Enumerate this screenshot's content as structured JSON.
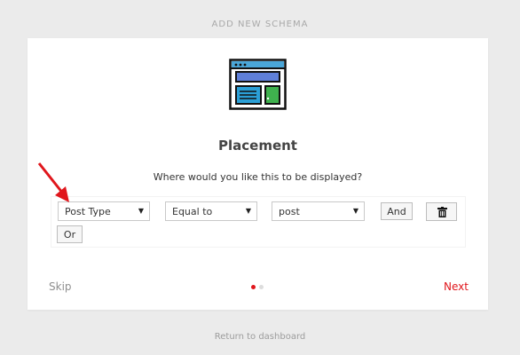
{
  "header": {
    "title": "ADD NEW SCHEMA"
  },
  "wizard": {
    "icon": "placement-layout-icon",
    "heading": "Placement",
    "question": "Where would you like this to be displayed?",
    "rule": {
      "field": {
        "value": "Post Type",
        "icon": "caret-down-icon"
      },
      "operator": {
        "value": "Equal to",
        "icon": "caret-down-icon"
      },
      "target": {
        "value": "post",
        "icon": "caret-down-icon"
      },
      "and_label": "And",
      "or_label": "Or",
      "delete_icon": "trash-icon"
    },
    "skip_label": "Skip",
    "next_label": "Next",
    "steps": {
      "current": 1,
      "total": 2
    }
  },
  "footer": {
    "return_label": "Return to dashboard"
  },
  "annotation": {
    "arrow_color": "#e0161c",
    "arrow_icon": "red-arrow-icon"
  },
  "colors": {
    "accent": "#e0161c",
    "background": "#ebebeb",
    "card": "#ffffff"
  }
}
